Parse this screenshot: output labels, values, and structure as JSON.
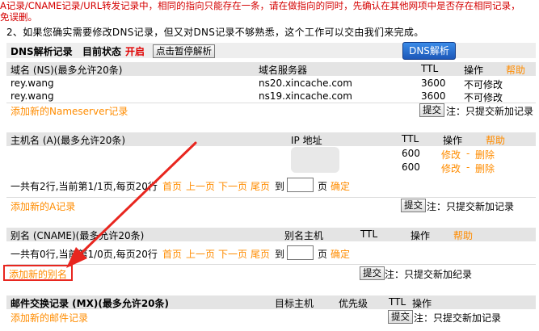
{
  "notice": {
    "line1": "A记录/CNAME记录/URL转发记录中，相同的指向只能存在一条，请在做指向的同时，先确认在其他网项中是否存在相同记录，",
    "line2": "免误删。",
    "line3": "2、如果您确实需要修改DNS记录，但又对DNS记录不够熟悉，这个工作可以交由我们来完成。"
  },
  "status_bar": {
    "title": "DNS解析记录",
    "status_label": "目前状态",
    "status_value": "开启",
    "pause_button": "点击暂停解析",
    "dns_button": "DNS解析"
  },
  "ns": {
    "headers": [
      "域名 (NS)(最多允许20条)",
      "域名服务器",
      "TTL",
      "操作",
      "帮助"
    ],
    "rows": [
      {
        "domain": "rey.wang",
        "server": "ns20.xincache.com",
        "ttl": "3600",
        "op": "不可修改"
      },
      {
        "domain": "rey.wang",
        "server": "ns19.xincache.com",
        "ttl": "3600",
        "op": "不可修改"
      }
    ],
    "add_link": "添加新的Nameserver记录",
    "submit": "提交",
    "submit_note": "注：只提交新加记录"
  },
  "a": {
    "headers": [
      "主机名 (A)(最多允许20条)",
      "IP 地址",
      "TTL",
      "操作",
      "帮助"
    ],
    "rows": [
      {
        "ttl": "600",
        "edit": "修改",
        "dash": "-",
        "del": "删除"
      },
      {
        "ttl": "600",
        "edit": "修改",
        "dash": "-",
        "del": "删除"
      }
    ],
    "pager_text": "一共有2行,当前第1/1页,每页20行",
    "first": "首页",
    "prev": "上一页",
    "next": "下一页",
    "last": "尾页",
    "goto": "到",
    "page": "页",
    "confirm": "确定",
    "add_link": "添加新的A记录",
    "submit": "提交",
    "submit_note": "注：只提交新加记录"
  },
  "cname": {
    "headers": [
      "别名 (CNAME)(最多允许20条)",
      "别名主机",
      "TTL",
      "操作",
      "帮助"
    ],
    "pager_text": "一共有0行,当前第1/0页,每页20行",
    "first": "首页",
    "prev": "上一页",
    "next": "下一页",
    "last": "尾页",
    "goto": "到",
    "page": "页",
    "confirm": "确定",
    "add_link": "添加新的别名",
    "submit": "提交",
    "submit_note": "注：只提交新加纪录"
  },
  "mx": {
    "headers": [
      "邮件交换记录 (MX)(最多允许20条)",
      "目标主机",
      "优先级",
      "TTL",
      "操作"
    ],
    "add_link": "添加新的邮件记录",
    "submit": "提交",
    "submit_note": "注：只提交新加记录"
  },
  "colors": {
    "accent_orange": "#ff8c00",
    "alert_red": "#d40000",
    "annotation_red": "#e8261f",
    "header_bg": "#e4e4e4",
    "dns_button_blue": "#2a6fd0"
  }
}
